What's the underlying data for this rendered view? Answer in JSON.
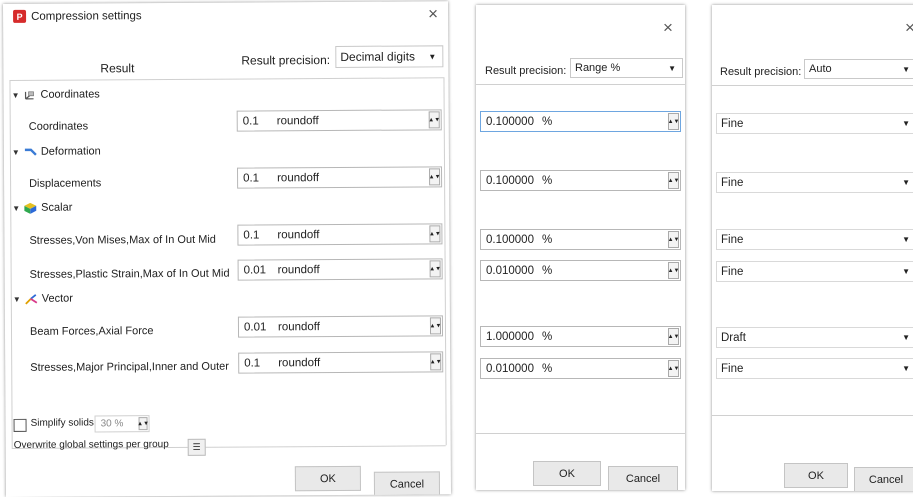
{
  "dialog1": {
    "title": "Compression settings",
    "column_result": "Result",
    "precision_label": "Result precision:",
    "precision_value": "Decimal digits",
    "groups": [
      "Coordinates",
      "Deformation",
      "Scalar",
      "Vector"
    ],
    "rows": [
      {
        "label": "Coordinates",
        "value": "0.1",
        "unit": "roundoff"
      },
      {
        "label": "Displacements",
        "value": "0.1",
        "unit": "roundoff"
      },
      {
        "label": "Stresses,Von Mises,Max of In Out Mid",
        "value": "0.1",
        "unit": "roundoff"
      },
      {
        "label": "Stresses,Plastic Strain,Max of In Out Mid",
        "value": "0.01",
        "unit": "roundoff"
      },
      {
        "label": "Beam Forces,Axial Force",
        "value": "0.01",
        "unit": "roundoff"
      },
      {
        "label": "Stresses,Major Principal,Inner and Outer",
        "value": "0.1",
        "unit": "roundoff"
      }
    ],
    "simplify_label": "Simplify solids",
    "simplify_value": "30 %",
    "overwrite_label": "Overwrite global settings per group",
    "ok": "OK",
    "cancel": "Cancel",
    "close": "×"
  },
  "dialog2": {
    "precision_label": "Result precision:",
    "precision_value": "Range %",
    "rows": [
      {
        "value": "0.100000",
        "unit": "%"
      },
      {
        "value": "0.100000",
        "unit": "%"
      },
      {
        "value": "0.100000",
        "unit": "%"
      },
      {
        "value": "0.010000",
        "unit": "%"
      },
      {
        "value": "1.000000",
        "unit": "%"
      },
      {
        "value": "0.010000",
        "unit": "%"
      }
    ],
    "ok": "OK",
    "cancel": "Cancel",
    "close": "×"
  },
  "dialog3": {
    "precision_label": "Result precision:",
    "precision_value": "Auto",
    "rows": [
      "Fine",
      "Fine",
      "Fine",
      "Fine",
      "Draft",
      "Fine"
    ],
    "ok": "OK",
    "cancel": "Cancel",
    "close": "×"
  },
  "icons": {
    "app": "app-logo-icon",
    "coordinates": "coordinates-axes-icon",
    "deformation": "deformation-icon",
    "scalar": "scalar-cube-icon",
    "vector": "vector-arrows-icon"
  }
}
